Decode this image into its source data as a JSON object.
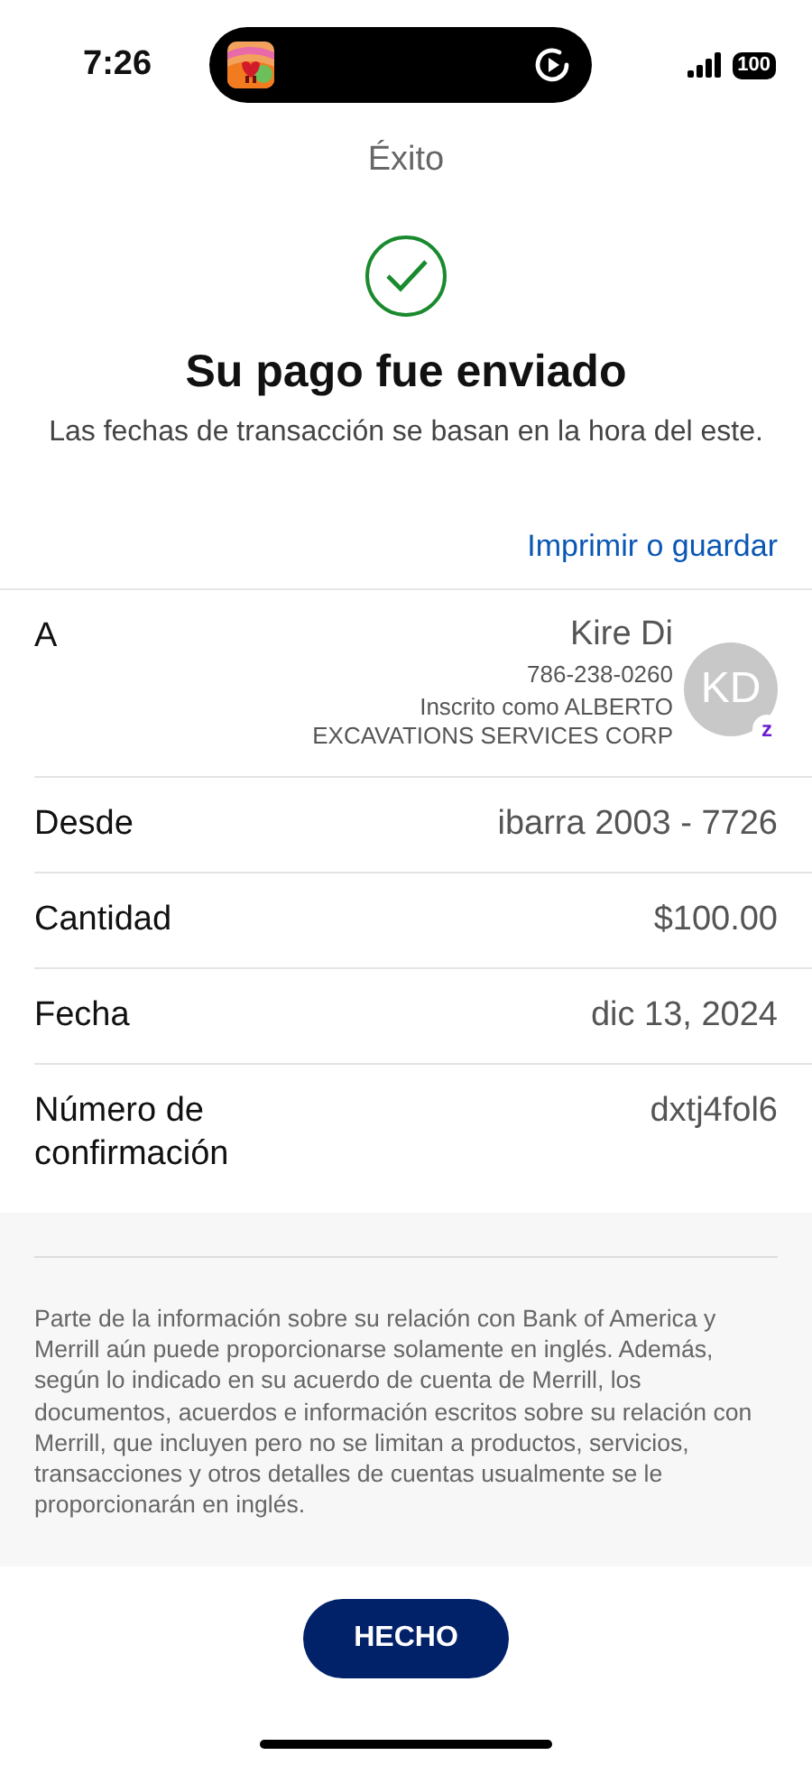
{
  "status_bar": {
    "time": "7:26",
    "battery": "100"
  },
  "header": {
    "title": "Éxito"
  },
  "result": {
    "title": "Su pago fue enviado",
    "subtitle": "Las fechas de transacción se basan en la hora del este."
  },
  "print_link": "Imprimir o guardar",
  "details": [
    {
      "kind": "recipient",
      "label": "A",
      "name": "Kire Di",
      "phone": "786-238-0260",
      "enrolled": "Inscrito como ALBERTO EXCAVATIONS SERVICES CORP",
      "initials": "KD",
      "badge": "z"
    },
    {
      "kind": "detail",
      "label": "Desde",
      "value": "ibarra 2003 - 7726"
    },
    {
      "kind": "detail",
      "label": "Cantidad",
      "value": "$100.00"
    },
    {
      "kind": "detail",
      "label": "Fecha",
      "value": "dic 13, 2024"
    },
    {
      "kind": "detail",
      "label": "Número de confirmación",
      "value": "dxtj4fol6"
    }
  ],
  "disclaimer": "Parte de la información sobre su relación con Bank of America y Merrill aún puede proporcionarse solamente en inglés. Además, según lo indicado en su acuerdo de cuenta de Merrill, los documentos, acuerdos e información escritos sobre su relación con Merrill, que incluyen pero no se limitan a productos, servicios, transacciones y otros detalles de cuentas usualmente se le proporcionarán en inglés.",
  "done_button": "HECHO"
}
